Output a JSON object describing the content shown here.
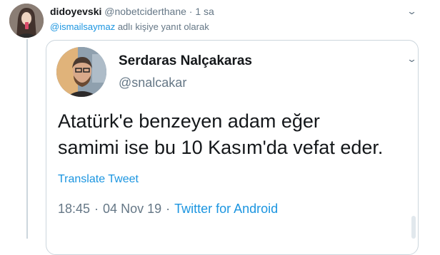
{
  "reply_tweet": {
    "display_name": "didoyevski",
    "handle": "@nobetciderthane",
    "separator": "·",
    "time": "1 sa",
    "reply_to_handle": "@ismailsaymaz",
    "reply_suffix": " adlı kişiye yanıt olarak"
  },
  "quoted_tweet": {
    "display_name": "Serdaras Nalçakaras",
    "handle": "@snalcakar",
    "text": "Atatürk'e benzeyen adam eğer\nsamimi ise bu 10 Kasım'da vefat eder.",
    "translate_label": "Translate Tweet",
    "time": "18:45",
    "separator": "·",
    "date": "04 Nov 19",
    "source": "Twitter for Android"
  },
  "icons": {
    "more_menu": "chevron-down-icon"
  },
  "colors": {
    "link": "#1b95e0",
    "meta": "#657786",
    "border": "#ccd6dd"
  }
}
